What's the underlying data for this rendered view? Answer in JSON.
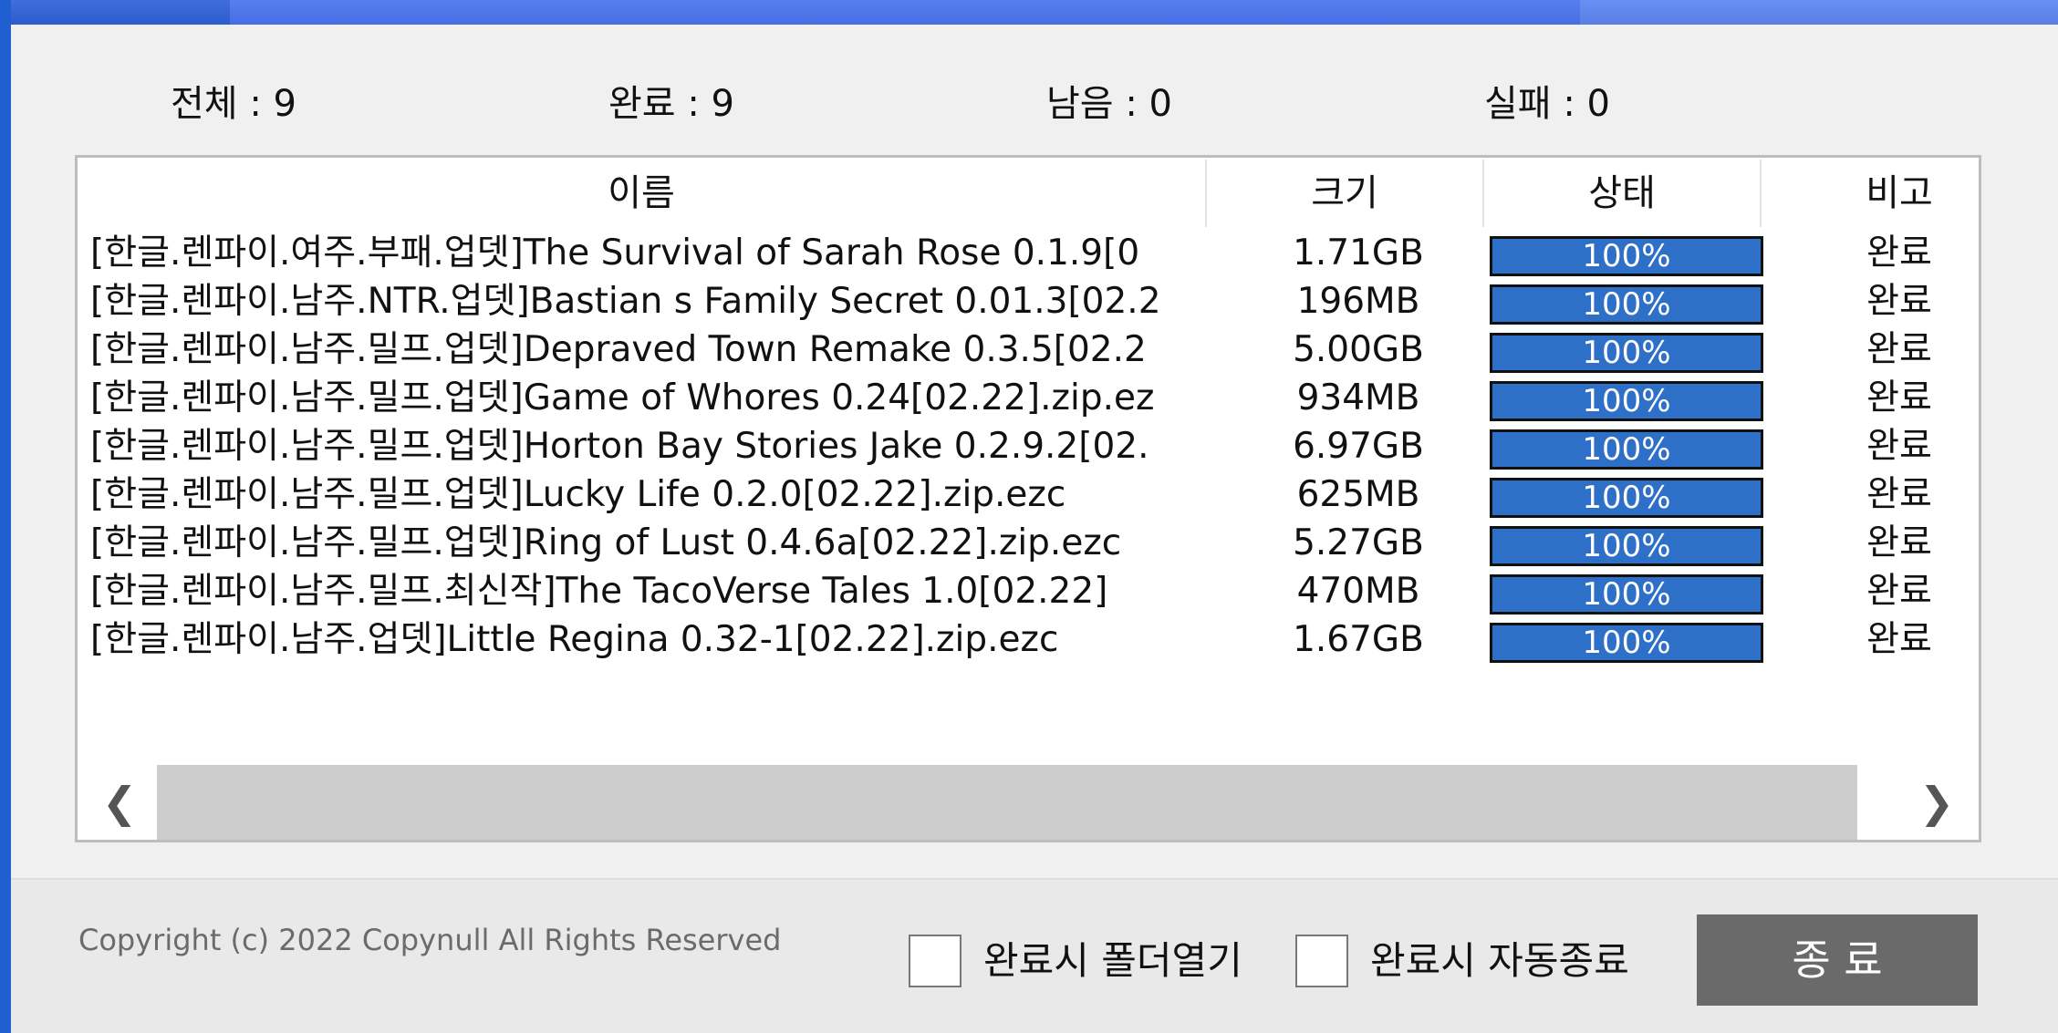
{
  "stats": {
    "total": "전체 : 9",
    "done": "완료 : 9",
    "remaining": "남음 : 0",
    "failed": "실패 : 0"
  },
  "table": {
    "columns": [
      "이름",
      "크기",
      "상태",
      "비고"
    ],
    "rows": [
      {
        "name": "[한글.렌파이.여주.부패.업뎃]The Survival of Sarah Rose 0.1.9[0",
        "size": "1.71GB",
        "progress": 100,
        "status": "100%",
        "note": "완료"
      },
      {
        "name": "[한글.렌파이.남주.NTR.업뎃]Bastian s Family Secret 0.01.3[02.2",
        "size": "196MB",
        "progress": 100,
        "status": "100%",
        "note": "완료"
      },
      {
        "name": "[한글.렌파이.남주.밀프.업뎃]Depraved Town Remake 0.3.5[02.2",
        "size": "5.00GB",
        "progress": 100,
        "status": "100%",
        "note": "완료"
      },
      {
        "name": "[한글.렌파이.남주.밀프.업뎃]Game of Whores 0.24[02.22].zip.ez",
        "size": "934MB",
        "progress": 100,
        "status": "100%",
        "note": "완료"
      },
      {
        "name": "[한글.렌파이.남주.밀프.업뎃]Horton Bay Stories Jake 0.2.9.2[02.",
        "size": "6.97GB",
        "progress": 100,
        "status": "100%",
        "note": "완료"
      },
      {
        "name": "[한글.렌파이.남주.밀프.업뎃]Lucky Life 0.2.0[02.22].zip.ezc",
        "size": "625MB",
        "progress": 100,
        "status": "100%",
        "note": "완료"
      },
      {
        "name": "[한글.렌파이.남주.밀프.업뎃]Ring of Lust 0.4.6a[02.22].zip.ezc",
        "size": "5.27GB",
        "progress": 100,
        "status": "100%",
        "note": "완료"
      },
      {
        "name": "[한글.렌파이.남주.밀프.최신작]The TacoVerse Tales 1.0[02.22]",
        "size": "470MB",
        "progress": 100,
        "status": "100%",
        "note": "완료"
      },
      {
        "name": "[한글.렌파이.남주.업뎃]Little Regina 0.32-1[02.22].zip.ezc",
        "size": "1.67GB",
        "progress": 100,
        "status": "100%",
        "note": "완료"
      }
    ]
  },
  "footer": {
    "copyright": "Copyright (c) 2022 Copynull All Rights Reserved",
    "open_folder_label": "완료시 폴더열기",
    "auto_exit_label": "완료시 자동종료",
    "close_label": "종 료"
  },
  "colors": {
    "progress_fill": "#2e6fc8",
    "close_button": "#6a6a6a",
    "title_bar": "#4a74ef"
  }
}
